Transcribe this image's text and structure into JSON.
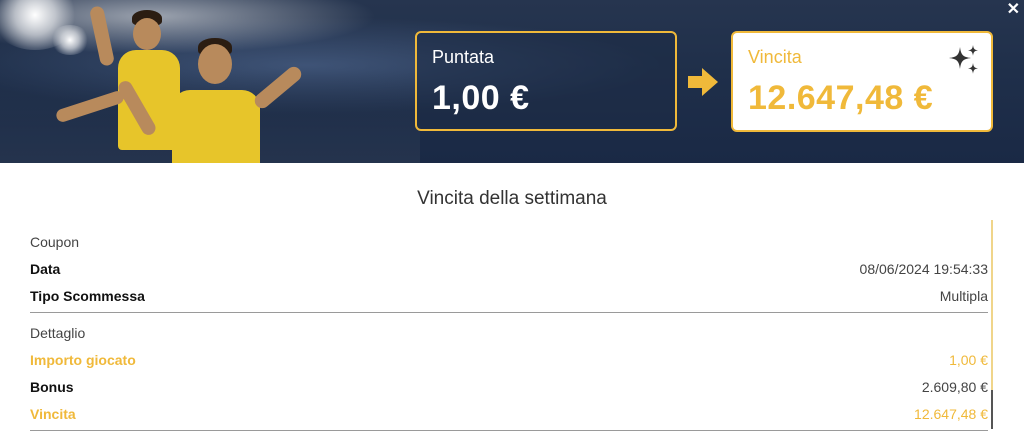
{
  "banner": {
    "stake_label": "Puntata",
    "stake_value": "1,00 €",
    "win_label": "Vincita",
    "win_value": "12.647,48 €"
  },
  "section_title": "Vincita della settimana",
  "coupon": {
    "heading": "Coupon",
    "rows": [
      {
        "label": "Data",
        "value": "08/06/2024 19:54:33"
      },
      {
        "label": "Tipo Scommessa",
        "value": "Multipla"
      }
    ]
  },
  "detail": {
    "heading": "Dettaglio",
    "rows": [
      {
        "label": "Importo giocato",
        "value": "1,00 €"
      },
      {
        "label": "Bonus",
        "value": "2.609,80 €"
      },
      {
        "label": "Vincita",
        "value": "12.647,48 €"
      }
    ]
  },
  "icons": {
    "close": "close-icon",
    "arrow": "arrow-right-icon",
    "sparkle": "sparkle-icon"
  },
  "colors": {
    "accent": "#f0b93a",
    "banner_bg": "#1f2f4a",
    "text": "#111111"
  }
}
